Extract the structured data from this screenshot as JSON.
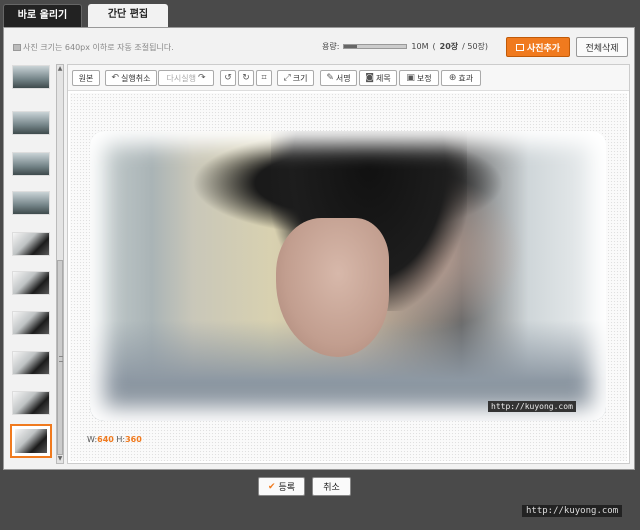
{
  "tabs": {
    "upload": "바로 올리기",
    "edit": "간단 편집"
  },
  "notice": "사진 크기는 640px 이하로 자동 조절됩니다.",
  "capacity": {
    "label": "용량:",
    "used": "10M",
    "count_open": "(",
    "count": "20장",
    "total": " / 50장)",
    "fill_ratio": 0.2
  },
  "buttons": {
    "add_photo": "사진추가",
    "delete_all": "전체삭제",
    "register": "등록",
    "cancel": "취소"
  },
  "toolbar": {
    "original": "원본",
    "undo": "실행취소",
    "redo": "다시실행",
    "resize": "크기",
    "signature": "서명",
    "caption": "제목",
    "correct": "보정",
    "effect": "효과"
  },
  "image": {
    "watermark": "http://kuyong.com",
    "width_label": "W:",
    "width": "640",
    "height_label": "H:",
    "height": "360"
  },
  "page_watermark": "http://kuyong.com",
  "colors": {
    "accent": "#f07a1e"
  },
  "icons": [
    "undo-icon",
    "redo-icon",
    "rotate-left-icon",
    "rotate-right-icon",
    "crop-icon",
    "resize-icon",
    "pen-icon",
    "caption-icon",
    "monitor-icon",
    "magnifier-icon"
  ]
}
